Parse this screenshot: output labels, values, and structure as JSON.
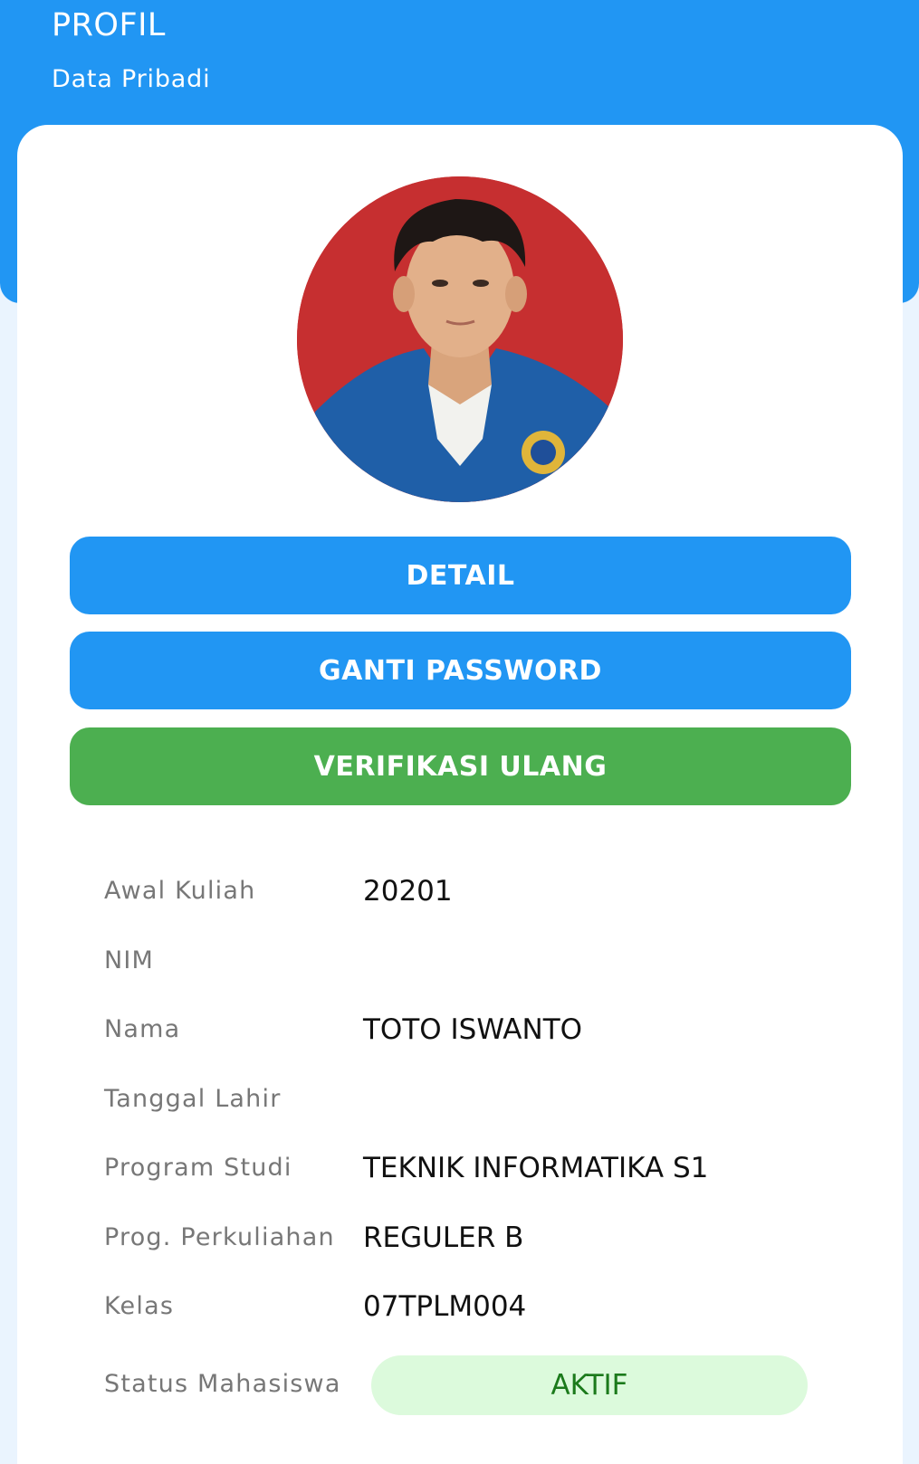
{
  "header": {
    "title": "PROFIL",
    "subtitle": "Data Pribadi"
  },
  "buttons": {
    "detail": "DETAIL",
    "change_password": "GANTI PASSWORD",
    "reverify": "VERIFIKASI ULANG"
  },
  "info": {
    "start_label": "Awal Kuliah",
    "start_value": "20201",
    "nim_label": "NIM",
    "nim_value": "",
    "name_label": "Nama",
    "name_value": "TOTO ISWANTO",
    "birth_label": "Tanggal Lahir",
    "birth_value": "",
    "program_label": "Program Studi",
    "program_value": "TEKNIK INFORMATIKA S1",
    "class_program_label": "Prog. Perkuliahan",
    "class_program_value": "REGULER B",
    "class_label": "Kelas",
    "class_value": "07TPLM004",
    "status_label": "Status Mahasiswa",
    "status_value": "AKTIF"
  },
  "colors": {
    "primary": "#2196f3",
    "success": "#4caf50",
    "status_bg": "#dcfadc",
    "status_text": "#1b7a1b"
  }
}
